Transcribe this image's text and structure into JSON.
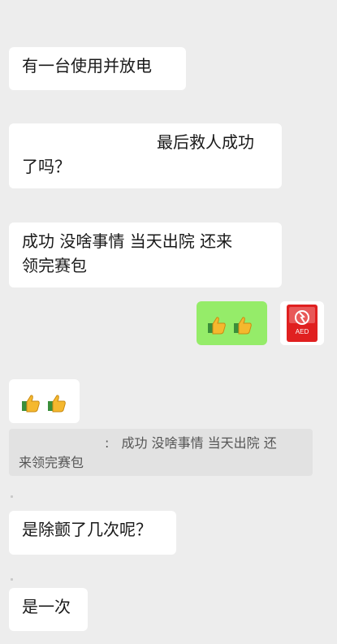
{
  "messages": [
    {
      "text": "有一台使用并放电"
    },
    {
      "line1": "最后救人成功",
      "line2": "了吗？"
    },
    {
      "line1": "成功 没啥事情 当天出院 还来",
      "line2": "领完赛包"
    },
    {
      "emoji": [
        "thumbs-up-icon",
        "thumbs-up-icon"
      ]
    },
    {
      "emoji": [
        "thumbs-up-icon",
        "thumbs-up-icon"
      ]
    },
    {
      "text": "是除颤了几次呢？"
    },
    {
      "text": "是一次"
    }
  ],
  "quote": {
    "separator": ":",
    "line1": "成功 没啥事情 当天出院 还",
    "line2": "来领完赛包"
  },
  "avatar": {
    "icon": "aed-device-icon",
    "label": "AED"
  },
  "colors": {
    "background": "#ededed",
    "bubble_other": "#ffffff",
    "bubble_self": "#95ec69",
    "quote": "#e2e2e2"
  }
}
